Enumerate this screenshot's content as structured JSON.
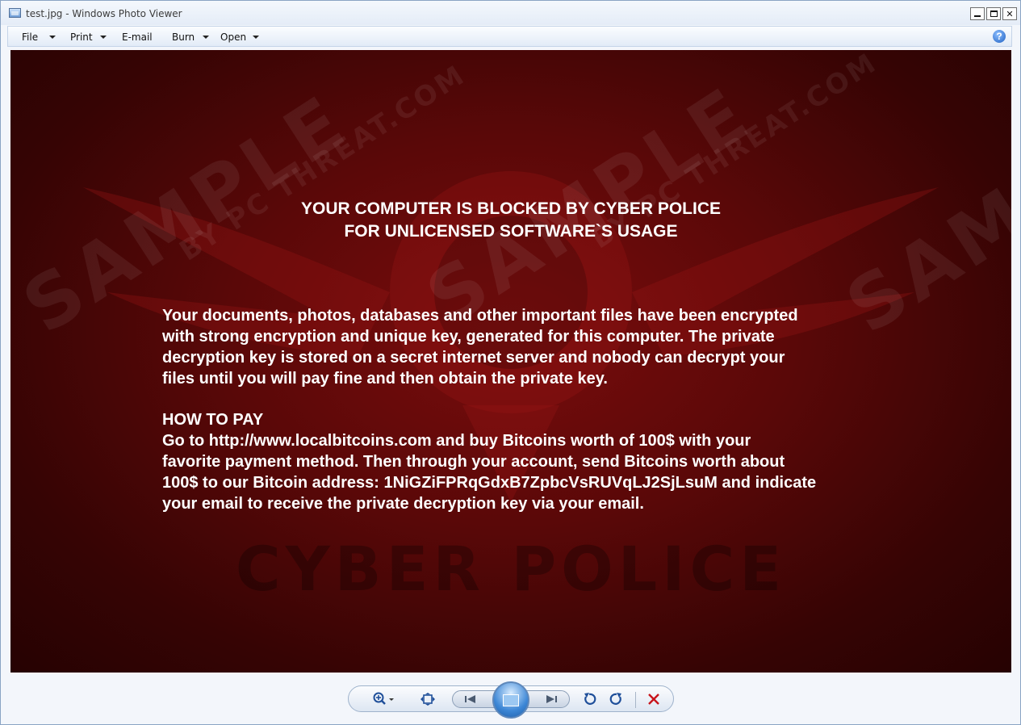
{
  "window": {
    "title": "test.jpg - Windows Photo Viewer",
    "controls": [
      "minimize",
      "maximize",
      "close"
    ]
  },
  "menu": {
    "items": [
      {
        "label": "File",
        "has_dropdown": true
      },
      {
        "label": "Print",
        "has_dropdown": true
      },
      {
        "label": "E-mail",
        "has_dropdown": false
      },
      {
        "label": "Burn",
        "has_dropdown": true
      },
      {
        "label": "Open",
        "has_dropdown": true
      }
    ],
    "help_icon": "help-icon"
  },
  "image": {
    "headline_line1": "YOUR COMPUTER IS BLOCKED BY CYBER POLICE",
    "headline_line2": "FOR UNLICENSED SOFTWARE`S USAGE",
    "para1_lines": [
      "Your documents, photos, databases and other important files have been encrypted",
      "with strong encryption and unique key, generated for this computer. The private",
      "decryption key is stored on a secret internet server and nobody can decrypt your",
      "files until you will pay fine and then obtain the private key."
    ],
    "pay_title": "HOW TO PAY",
    "para2_lines": [
      "Go to http://www.localbitcoins.com and buy Bitcoins worth of 100$ with your",
      "favorite payment method. Then through your account, send Bitcoins worth about",
      "100$ to our Bitcoin address: 1NiGZiFPRqGdxB7ZpbcVsRUVqLJ2SjLsuM and indicate",
      "your email to receive the private decryption key via your email."
    ],
    "background_text": "CYBER POLICE",
    "watermark_main": "SAMPLE",
    "watermark_sub": "BY PC THREAT.COM",
    "colors": {
      "background": "#5a0808",
      "text": "#ffffff"
    }
  },
  "toolbar": {
    "icons": [
      "zoom-icon",
      "actual-size-icon",
      "previous-icon",
      "slideshow-icon",
      "next-icon",
      "rotate-counterclockwise-icon",
      "rotate-clockwise-icon",
      "delete-icon"
    ]
  }
}
